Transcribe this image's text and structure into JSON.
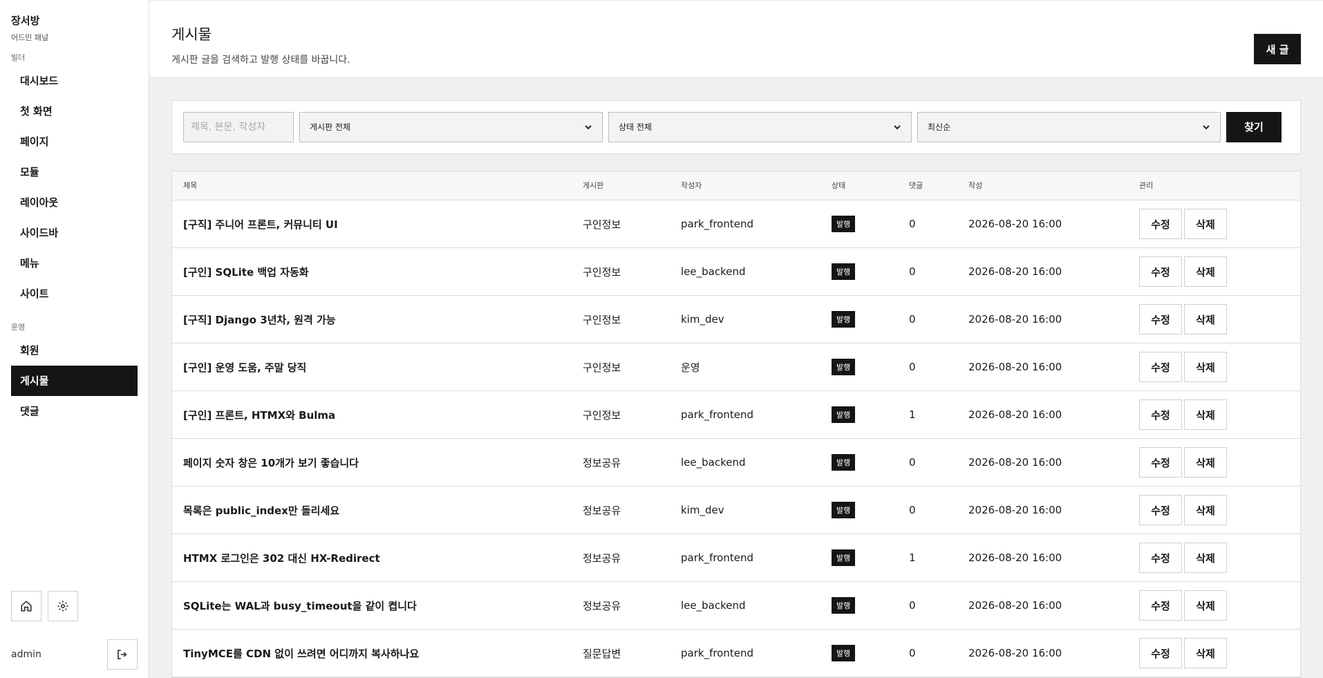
{
  "brand": {
    "title": "장서방",
    "subtitle": "어드민 패널"
  },
  "sidebar": {
    "sections": [
      {
        "label": "빌더",
        "items": [
          "대시보드",
          "첫 화면",
          "페이지",
          "모듈",
          "레이아웃",
          "사이드바",
          "메뉴",
          "사이트"
        ]
      },
      {
        "label": "운영",
        "items": [
          "회원",
          "게시물",
          "댓글"
        ]
      }
    ],
    "active_item": "게시물",
    "user": "admin"
  },
  "header": {
    "title": "게시물",
    "description": "게시판 글을 검색하고 발행 상태를 바꿉니다.",
    "new_button": "새 글"
  },
  "filters": {
    "search_placeholder": "제목, 본문, 작성자",
    "board": "게시판 전체",
    "status": "상태 전체",
    "sort": "최신순",
    "find_button": "찾기"
  },
  "table": {
    "columns": [
      "제목",
      "게시판",
      "작성자",
      "상태",
      "댓글",
      "작성",
      "관리"
    ],
    "edit_label": "수정",
    "delete_label": "삭제",
    "rows": [
      {
        "title": "[구직] 주니어 프론트, 커뮤니티 UI",
        "board": "구인정보",
        "author": "park_frontend",
        "status": "발행",
        "comments": "0",
        "created": "2026-08-20 16:00"
      },
      {
        "title": "[구인] SQLite 백업 자동화",
        "board": "구인정보",
        "author": "lee_backend",
        "status": "발행",
        "comments": "0",
        "created": "2026-08-20 16:00"
      },
      {
        "title": "[구직] Django 3년차, 원격 가능",
        "board": "구인정보",
        "author": "kim_dev",
        "status": "발행",
        "comments": "0",
        "created": "2026-08-20 16:00"
      },
      {
        "title": "[구인] 운영 도움, 주말 당직",
        "board": "구인정보",
        "author": "운영",
        "status": "발행",
        "comments": "0",
        "created": "2026-08-20 16:00"
      },
      {
        "title": "[구인] 프론트, HTMX와 Bulma",
        "board": "구인정보",
        "author": "park_frontend",
        "status": "발행",
        "comments": "1",
        "created": "2026-08-20 16:00"
      },
      {
        "title": "페이지 숫자 창은 10개가 보기 좋습니다",
        "board": "정보공유",
        "author": "lee_backend",
        "status": "발행",
        "comments": "0",
        "created": "2026-08-20 16:00"
      },
      {
        "title": "목록은 public_index만 돌리세요",
        "board": "정보공유",
        "author": "kim_dev",
        "status": "발행",
        "comments": "0",
        "created": "2026-08-20 16:00"
      },
      {
        "title": "HTMX 로그인은 302 대신 HX-Redirect",
        "board": "정보공유",
        "author": "park_frontend",
        "status": "발행",
        "comments": "1",
        "created": "2026-08-20 16:00"
      },
      {
        "title": "SQLite는 WAL과 busy_timeout을 같이 켭니다",
        "board": "정보공유",
        "author": "lee_backend",
        "status": "발행",
        "comments": "0",
        "created": "2026-08-20 16:00"
      },
      {
        "title": "TinyMCE를 CDN 없이 쓰려면 어디까지 복사하나요",
        "board": "질문답변",
        "author": "park_frontend",
        "status": "발행",
        "comments": "0",
        "created": "2026-08-20 16:00"
      }
    ]
  },
  "icons": {
    "home": "home-icon",
    "settings": "gear-icon",
    "logout": "logout-icon",
    "dropdown": "chevron-down-icon"
  },
  "colors": {
    "accent": "#151515",
    "background": "#f0f0f0",
    "border": "#dcdcdc"
  }
}
